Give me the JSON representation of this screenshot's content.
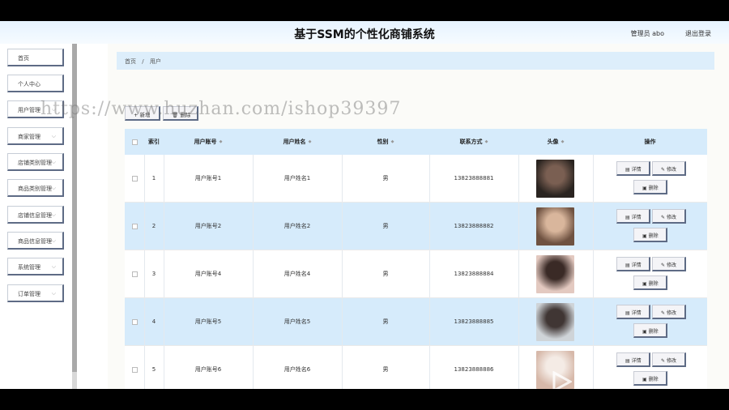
{
  "header": {
    "title": "基于SSM的个性化商铺系统",
    "admin": "管理员 abo",
    "logout": "退出登录"
  },
  "sidebar": {
    "items": [
      {
        "label": "首页",
        "chevron": false
      },
      {
        "label": "个人中心",
        "chevron": false
      },
      {
        "label": "用户管理",
        "chevron": true
      },
      {
        "label": "商家管理",
        "chevron": true
      },
      {
        "label": "店铺类别管理",
        "chevron": true
      },
      {
        "label": "商品类别管理",
        "chevron": true
      },
      {
        "label": "店铺信息管理",
        "chevron": true
      },
      {
        "label": "商品信息管理",
        "chevron": true
      },
      {
        "label": "系统管理",
        "chevron": true
      },
      {
        "label": "订单管理",
        "chevron": true
      }
    ]
  },
  "breadcrumb": {
    "home": "首页",
    "sep": "/",
    "current": "用户"
  },
  "toolbar": {
    "add_label": "+ 新增",
    "delete_label": "🗑 删除"
  },
  "table": {
    "headers": {
      "index": "索引",
      "account": "用户账号",
      "name": "用户姓名",
      "gender": "性别",
      "phone": "联系方式",
      "avatar": "头像",
      "actions": "操作"
    },
    "rows": [
      {
        "index": "1",
        "account": "用户账号1",
        "name": "用户姓名1",
        "gender": "男",
        "phone": "13823888881"
      },
      {
        "index": "2",
        "account": "用户账号2",
        "name": "用户姓名2",
        "gender": "男",
        "phone": "13823888882"
      },
      {
        "index": "3",
        "account": "用户账号4",
        "name": "用户姓名4",
        "gender": "男",
        "phone": "13823888884"
      },
      {
        "index": "4",
        "account": "用户账号5",
        "name": "用户姓名5",
        "gender": "男",
        "phone": "13823888885"
      },
      {
        "index": "5",
        "account": "用户账号6",
        "name": "用户姓名6",
        "gender": "男",
        "phone": "13823888886"
      }
    ],
    "actions": {
      "detail": "详情",
      "edit": "修改",
      "delete": "删除"
    }
  },
  "watermark": "https://www.huzhan.com/ishop39397"
}
